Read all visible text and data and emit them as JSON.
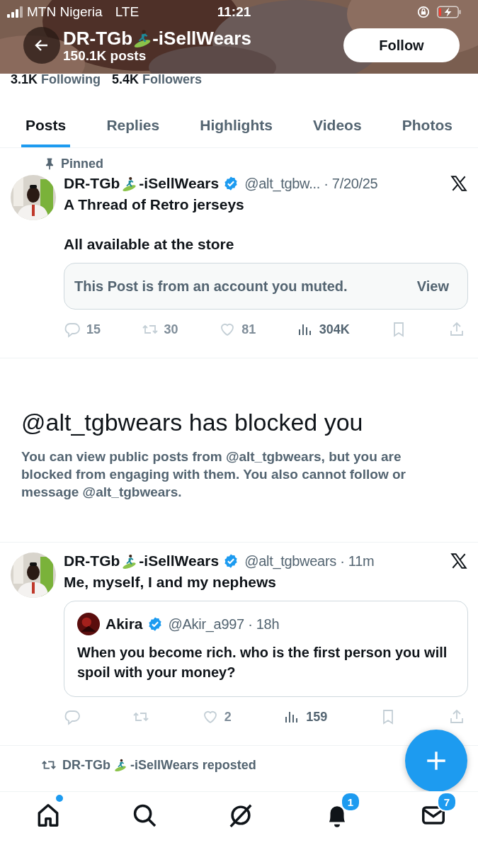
{
  "status_bar": {
    "carrier": "MTN Nigeria",
    "network": "LTE",
    "time": "11:21"
  },
  "header": {
    "name_start": "DR-TGb",
    "name_end": "-iSellWears",
    "posts": "150.1K posts",
    "follow_button": "Follow"
  },
  "stats": [
    {
      "count": "3.1K",
      "label": "Following"
    },
    {
      "count": "5.4K",
      "label": "Followers"
    }
  ],
  "tabs": [
    {
      "label": "Posts",
      "selected": true
    },
    {
      "label": "Replies",
      "selected": false
    },
    {
      "label": "Highlights",
      "selected": false
    },
    {
      "label": "Videos",
      "selected": false
    },
    {
      "label": "Photos",
      "selected": false
    }
  ],
  "feed": [
    {
      "kind": "post",
      "pinned_label": "Pinned",
      "author": {
        "name_start": "DR-TGb",
        "name_end": "-iSellWears",
        "verified": true,
        "handle_time": "@alt_tgbw... · 7/20/25"
      },
      "paragraphs": [
        "A Thread of Retro jerseys",
        "All available at the store"
      ],
      "muted_notice": {
        "text": "This Post is from an account you muted.",
        "button": "View"
      },
      "actions": [
        {
          "kind": "reply",
          "count": "15",
          "disabled": true
        },
        {
          "kind": "repost",
          "count": "30",
          "disabled": true
        },
        {
          "kind": "like",
          "count": "81",
          "disabled": true
        },
        {
          "kind": "views",
          "count": "304K",
          "disabled": false
        },
        {
          "kind": "bookmark",
          "disabled": true
        },
        {
          "kind": "share",
          "disabled": true
        }
      ]
    },
    {
      "kind": "notice",
      "title": "@alt_tgbwears has blocked you",
      "text": "You can view public posts from @alt_tgbwears, but you are blocked from engaging with them. You also cannot follow or message @alt_tgbwears."
    },
    {
      "kind": "post",
      "author": {
        "name_start": "DR-TGb",
        "name_end": "-iSellWears",
        "verified": true,
        "handle_time": "@alt_tgbwears · 11m"
      },
      "paragraphs": [
        "Me, myself, I and my nephews"
      ],
      "quote": {
        "name": "Akira",
        "verified": true,
        "handle_time": "@Akir_a997 · 18h",
        "text": "When you become rich. who is the first person you will spoil with your money?"
      },
      "actions": [
        {
          "kind": "reply",
          "disabled": true
        },
        {
          "kind": "repost",
          "disabled": true
        },
        {
          "kind": "like",
          "count": "2",
          "disabled": true
        },
        {
          "kind": "views",
          "count": "159",
          "disabled": false
        },
        {
          "kind": "bookmark",
          "disabled": true
        },
        {
          "kind": "share",
          "disabled": true
        }
      ]
    },
    {
      "kind": "repost_header",
      "name_start": "DR-TGb",
      "name_end": "-iSellWears reposted"
    }
  ],
  "nav": [
    {
      "kind": "home",
      "dot": true
    },
    {
      "kind": "search",
      "dot": false
    },
    {
      "kind": "grok",
      "dot": false
    },
    {
      "kind": "notifications",
      "badge": "1",
      "dot": false
    },
    {
      "kind": "messages",
      "badge": "7",
      "dot": false
    }
  ]
}
